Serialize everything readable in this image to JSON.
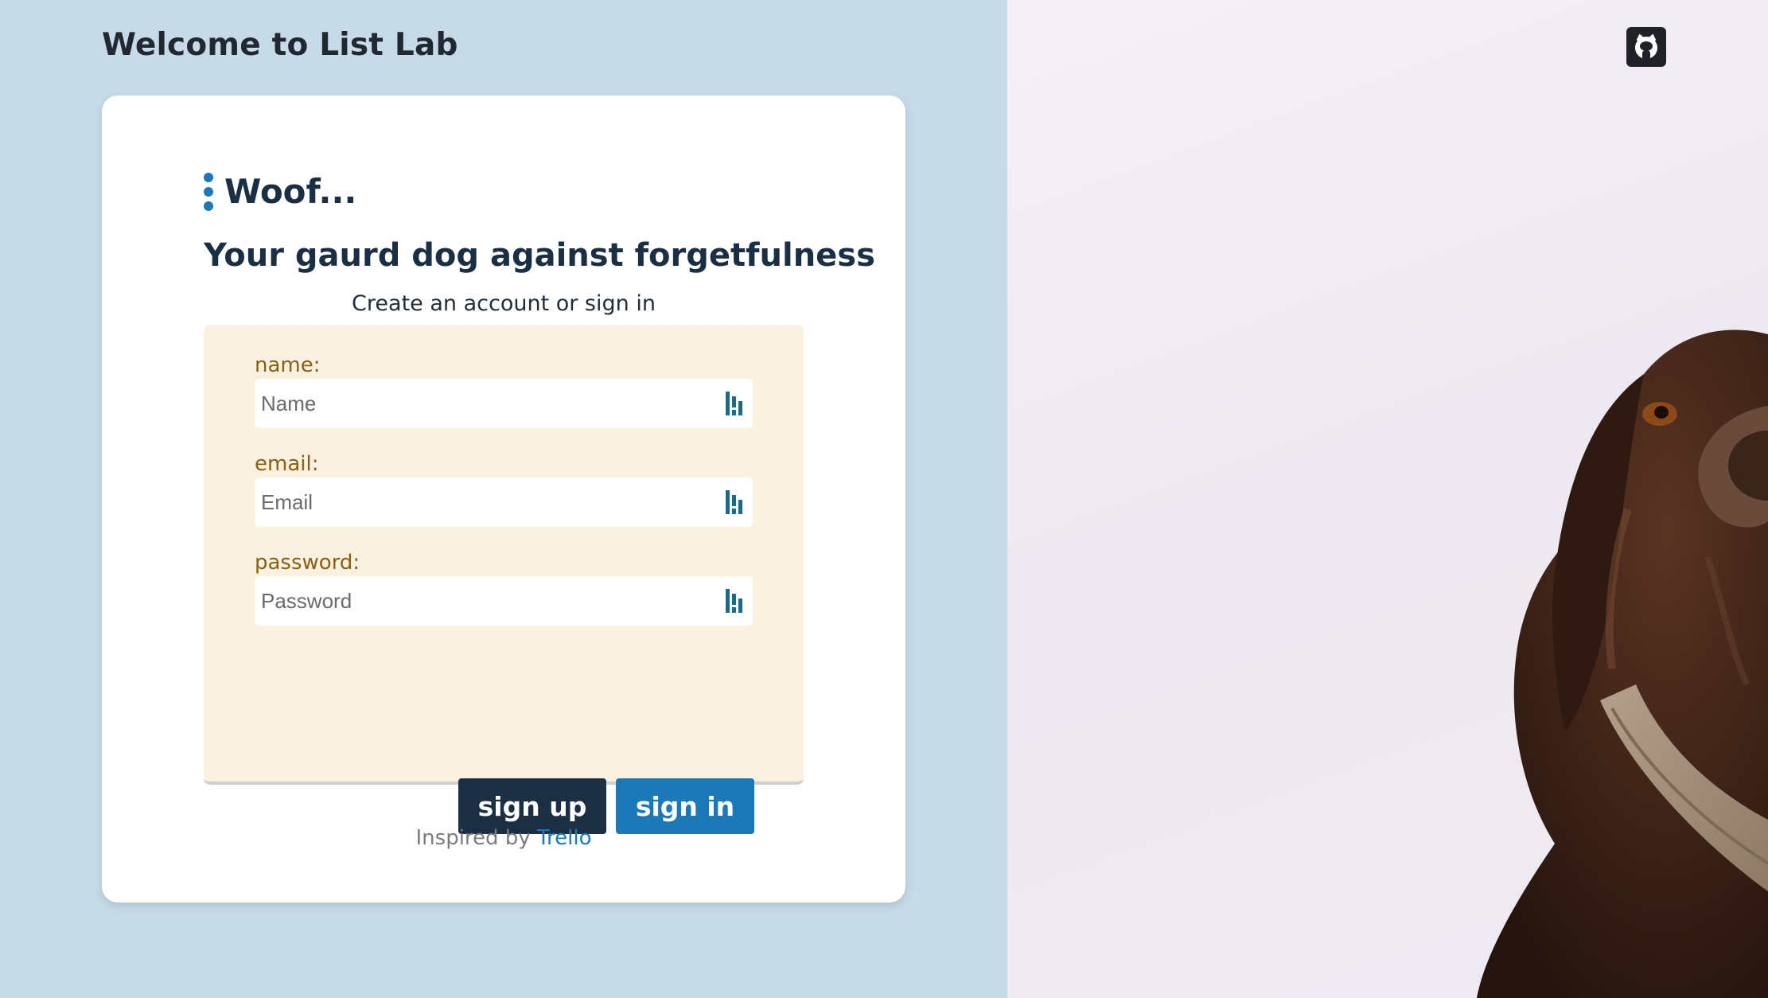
{
  "header": {
    "title": "Welcome to List Lab"
  },
  "card": {
    "brand": "Woof...",
    "tagline": "Your gaurd dog against forgetfulness",
    "subtitle": "Create an account or sign in",
    "form": {
      "name_label": "name:",
      "name_placeholder": "Name",
      "email_label": "email:",
      "email_placeholder": "Email",
      "password_label": "password:",
      "password_placeholder": "Password",
      "signup_label": "sign up",
      "signin_label": "sign in"
    },
    "footer": {
      "prefix": "Inspired by",
      "link_text": "Trello"
    }
  },
  "icons": {
    "github": "github-icon",
    "field_addon": "password-manager-icon",
    "brand_dots": "vertical-dots-icon"
  },
  "colors": {
    "left_background": "#c6dae8",
    "navy": "#1b2f44",
    "accent_blue": "#1c79b8",
    "form_background": "#faf1e0",
    "label_brown": "#8a5f12"
  }
}
